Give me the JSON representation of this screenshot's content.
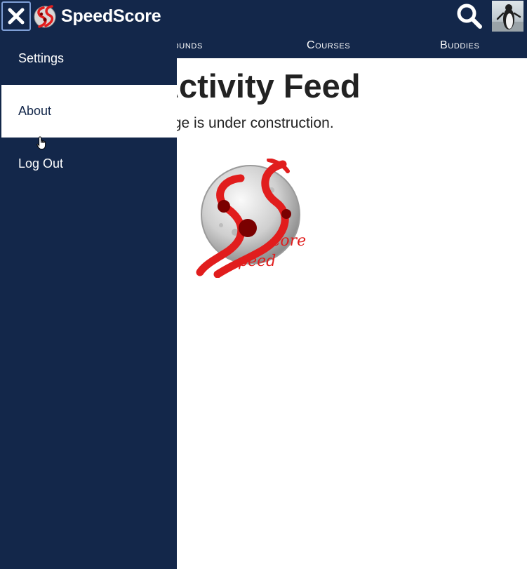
{
  "app": {
    "name": "SpeedScore"
  },
  "header": {
    "close_icon": "close-icon",
    "search_icon": "search-icon",
    "avatar_icon": "penguin-avatar"
  },
  "tabs": [
    {
      "label": "Rounds"
    },
    {
      "label": "Courses"
    },
    {
      "label": "Buddies"
    }
  ],
  "side_menu": {
    "items": [
      {
        "label": "Settings",
        "active": false
      },
      {
        "label": "About",
        "active": true
      },
      {
        "label": "Log Out",
        "active": false
      }
    ]
  },
  "main": {
    "title": "Activity Feed",
    "note": "This page is under construction."
  },
  "logo": {
    "text_top": "core",
    "text_bottom": "peed"
  },
  "colors": {
    "navbar": "#13274a",
    "accent_red": "#e11d1d",
    "dark_red": "#7a0000",
    "active_item_bg": "#ffffff"
  }
}
